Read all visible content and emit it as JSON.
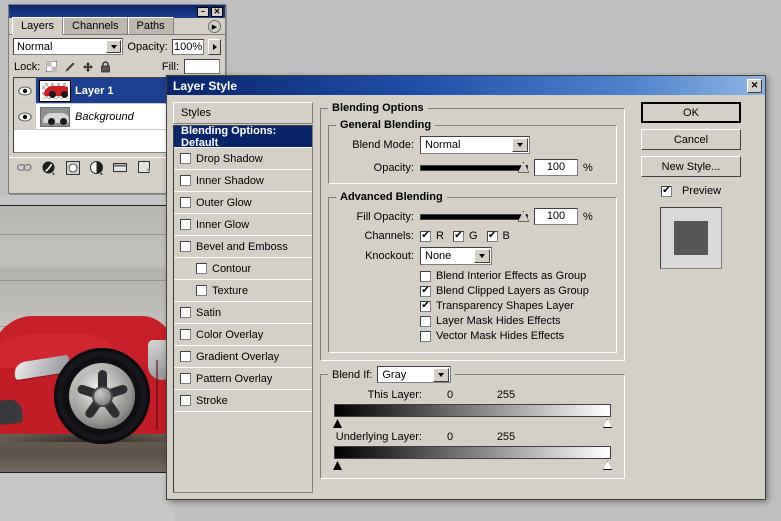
{
  "layers_palette": {
    "window_buttons": {
      "minimize": "–",
      "close": "✕"
    },
    "tabs": [
      {
        "label": "Layers",
        "active": true
      },
      {
        "label": "Channels",
        "active": false
      },
      {
        "label": "Paths",
        "active": false
      }
    ],
    "menu_icon": "▶",
    "blend_mode": "Normal",
    "opacity_label": "Opacity:",
    "opacity_value": "100%",
    "lock_label": "Lock:",
    "lock_icons": [
      "transparency-icon",
      "brush-icon",
      "move-icon",
      "lock-icon"
    ],
    "fill_label": "Fill:",
    "fill_value": "",
    "layers": [
      {
        "name": "Layer 1",
        "selected": true,
        "italic": false,
        "visible": true,
        "thumb": "red-car"
      },
      {
        "name": "Background",
        "selected": false,
        "italic": true,
        "visible": true,
        "thumb": "gray-car"
      }
    ],
    "bottom_tools": [
      "link-icon",
      "fx-icon",
      "mask-icon",
      "adjustment-icon",
      "group-icon",
      "new-layer-icon"
    ]
  },
  "dialog": {
    "title": "Layer Style",
    "close_label": "✕",
    "styles_header": "Styles",
    "styles_items": [
      {
        "label": "Blending Options: Default",
        "selected": true,
        "checkbox": false,
        "indented": false,
        "checked": false
      },
      {
        "label": "Drop Shadow",
        "selected": false,
        "checkbox": true,
        "indented": false,
        "checked": false
      },
      {
        "label": "Inner Shadow",
        "selected": false,
        "checkbox": true,
        "indented": false,
        "checked": false
      },
      {
        "label": "Outer Glow",
        "selected": false,
        "checkbox": true,
        "indented": false,
        "checked": false
      },
      {
        "label": "Inner Glow",
        "selected": false,
        "checkbox": true,
        "indented": false,
        "checked": false
      },
      {
        "label": "Bevel and Emboss",
        "selected": false,
        "checkbox": true,
        "indented": false,
        "checked": false
      },
      {
        "label": "Contour",
        "selected": false,
        "checkbox": true,
        "indented": true,
        "checked": false
      },
      {
        "label": "Texture",
        "selected": false,
        "checkbox": true,
        "indented": true,
        "checked": false
      },
      {
        "label": "Satin",
        "selected": false,
        "checkbox": true,
        "indented": false,
        "checked": false
      },
      {
        "label": "Color Overlay",
        "selected": false,
        "checkbox": true,
        "indented": false,
        "checked": false
      },
      {
        "label": "Gradient Overlay",
        "selected": false,
        "checkbox": true,
        "indented": false,
        "checked": false
      },
      {
        "label": "Pattern Overlay",
        "selected": false,
        "checkbox": true,
        "indented": false,
        "checked": false
      },
      {
        "label": "Stroke",
        "selected": false,
        "checkbox": true,
        "indented": false,
        "checked": false
      }
    ],
    "blending_options_legend": "Blending Options",
    "general_blending": {
      "legend": "General Blending",
      "blend_mode_label": "Blend Mode:",
      "blend_mode_value": "Normal",
      "opacity_label": "Opacity:",
      "opacity_value": "100",
      "opacity_percent": "%",
      "opacity_slider_pct": 100
    },
    "advanced_blending": {
      "legend": "Advanced Blending",
      "fill_opacity_label": "Fill Opacity:",
      "fill_opacity_value": "100",
      "fill_opacity_percent": "%",
      "fill_opacity_slider_pct": 100,
      "channels_label": "Channels:",
      "channels": [
        {
          "label": "R",
          "checked": true
        },
        {
          "label": "G",
          "checked": true
        },
        {
          "label": "B",
          "checked": true
        }
      ],
      "knockout_label": "Knockout:",
      "knockout_value": "None",
      "options": [
        {
          "label": "Blend Interior Effects as Group",
          "checked": false
        },
        {
          "label": "Blend Clipped Layers as Group",
          "checked": true
        },
        {
          "label": "Transparency Shapes Layer",
          "checked": true
        },
        {
          "label": "Layer Mask Hides Effects",
          "checked": false
        },
        {
          "label": "Vector Mask Hides Effects",
          "checked": false
        }
      ]
    },
    "blend_if": {
      "legend": "Blend If:",
      "channel_value": "Gray",
      "this_layer_label": "This Layer:",
      "this_layer_min": "0",
      "this_layer_max": "255",
      "underlying_layer_label": "Underlying Layer:",
      "underlying_layer_min": "0",
      "underlying_layer_max": "255"
    },
    "buttons": {
      "ok": "OK",
      "cancel": "Cancel",
      "new_style": "New Style...",
      "preview_label": "Preview",
      "preview_checked": true
    }
  },
  "colors": {
    "dialog_face": "#d4d0c8",
    "title_blue": "#0a246a",
    "selection_blue": "#1c3f8f",
    "car_red": "#c8202a",
    "preview_square": "#565656"
  }
}
